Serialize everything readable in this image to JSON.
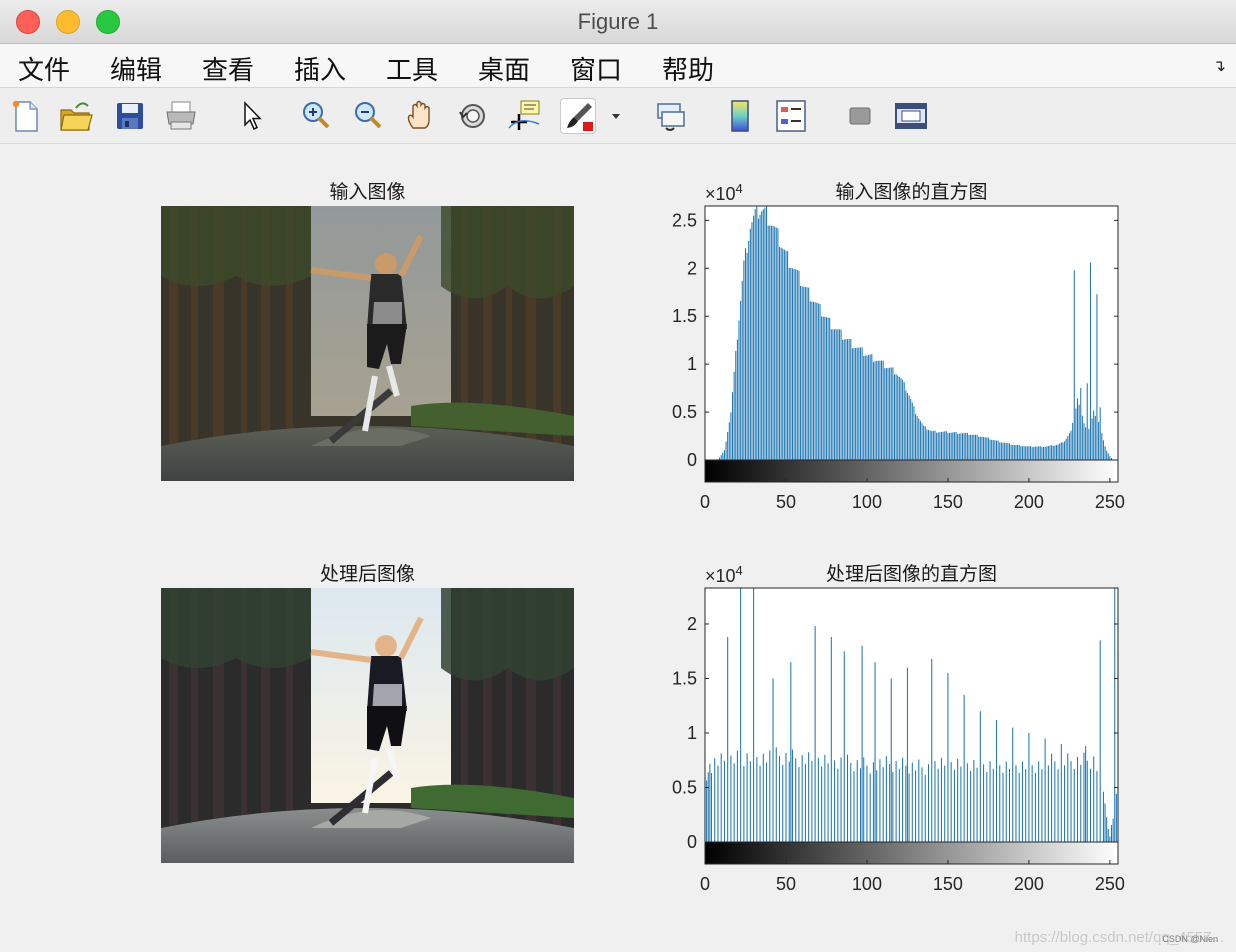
{
  "window": {
    "title": "Figure 1"
  },
  "menu": [
    "文件",
    "编辑",
    "查看",
    "插入",
    "工具",
    "桌面",
    "窗口",
    "帮助"
  ],
  "toolbar": [
    "new-figure-icon",
    "open-file-icon",
    "save-icon",
    "print-icon",
    "pointer-icon",
    "zoom-in-icon",
    "zoom-out-icon",
    "pan-hand-icon",
    "rotate-3d-icon",
    "data-cursor-icon",
    "brush-icon",
    "brush-dropdown-icon",
    "link-plot-icon",
    "colorbar-icon",
    "legend-icon",
    "hide-plot-tools-icon",
    "show-plot-tools-icon"
  ],
  "panels": {
    "input_image_title": "输入图像",
    "output_image_title": "处理后图像"
  },
  "chart_data": [
    {
      "type": "bar",
      "title": "输入图像的直方图",
      "exponent_label": "×10",
      "exponent": "4",
      "xlim": [
        0,
        255
      ],
      "ylim": [
        0,
        2.65
      ],
      "xticks": [
        "0",
        "50",
        "100",
        "150",
        "200",
        "250"
      ],
      "yticks": [
        "0",
        "0.5",
        "1",
        "1.5",
        "2",
        "2.5"
      ],
      "colorbar": "gray",
      "x_points": [
        0,
        8,
        12,
        16,
        20,
        24,
        28,
        32,
        35,
        38,
        42,
        46,
        50,
        55,
        60,
        66,
        72,
        78,
        85,
        92,
        100,
        106,
        112,
        118,
        122,
        126,
        130,
        135,
        140,
        150,
        160,
        170,
        180,
        190,
        200,
        210,
        218,
        222,
        226,
        228,
        230,
        232,
        234,
        236,
        238,
        240,
        242,
        244,
        246,
        248,
        250,
        252,
        255
      ],
      "values": [
        0,
        0,
        0.1,
        0.5,
        1.3,
        2.05,
        2.45,
        2.6,
        2.62,
        2.58,
        2.45,
        2.3,
        2.15,
        2.0,
        1.85,
        1.7,
        1.55,
        1.42,
        1.3,
        1.2,
        1.1,
        1.05,
        0.98,
        0.92,
        0.82,
        0.68,
        0.5,
        0.35,
        0.3,
        0.29,
        0.28,
        0.25,
        0.2,
        0.16,
        0.14,
        0.14,
        0.16,
        0.2,
        0.3,
        0.45,
        0.65,
        0.5,
        0.4,
        0.3,
        0.35,
        0.5,
        0.45,
        0.35,
        0.2,
        0.1,
        0.04,
        0,
        0
      ],
      "spikes": [
        [
          228,
          1.98
        ],
        [
          238,
          2.06
        ],
        [
          242,
          1.73
        ],
        [
          236,
          0.8
        ],
        [
          232,
          0.75
        ],
        [
          244,
          0.55
        ]
      ]
    },
    {
      "type": "bar",
      "title": "处理后图像的直方图",
      "exponent_label": "×10",
      "exponent": "4",
      "xlim": [
        0,
        255
      ],
      "ylim": [
        0,
        2.33
      ],
      "xticks": [
        "0",
        "50",
        "100",
        "150",
        "200",
        "250"
      ],
      "yticks": [
        "0",
        "0.5",
        "1",
        "1.5",
        "2"
      ],
      "colorbar": "gray",
      "base_points": [
        0,
        5,
        30,
        60,
        100,
        140,
        180,
        200,
        220,
        240,
        245,
        248,
        250,
        255
      ],
      "base_values": [
        0.55,
        0.7,
        0.78,
        0.75,
        0.7,
        0.68,
        0.68,
        0.7,
        0.72,
        0.75,
        0.6,
        0.2,
        0.05,
        0.5
      ],
      "spikes": [
        [
          14,
          1.88
        ],
        [
          22,
          2.33
        ],
        [
          30,
          2.33
        ],
        [
          42,
          1.5
        ],
        [
          53,
          1.65
        ],
        [
          68,
          1.98
        ],
        [
          78,
          1.88
        ],
        [
          86,
          1.75
        ],
        [
          97,
          1.8
        ],
        [
          105,
          1.65
        ],
        [
          115,
          1.5
        ],
        [
          125,
          1.6
        ],
        [
          140,
          1.68
        ],
        [
          150,
          1.55
        ],
        [
          160,
          1.35
        ],
        [
          170,
          1.2
        ],
        [
          180,
          1.12
        ],
        [
          190,
          1.05
        ],
        [
          200,
          1.0
        ],
        [
          210,
          0.95
        ],
        [
          220,
          0.9
        ],
        [
          235,
          0.88
        ],
        [
          244,
          1.85
        ],
        [
          253,
          2.33
        ],
        [
          255,
          1.75
        ]
      ]
    }
  ],
  "watermark": "https://blog.csdn.net/qq_4557...",
  "badge": "CSDN @Nien"
}
